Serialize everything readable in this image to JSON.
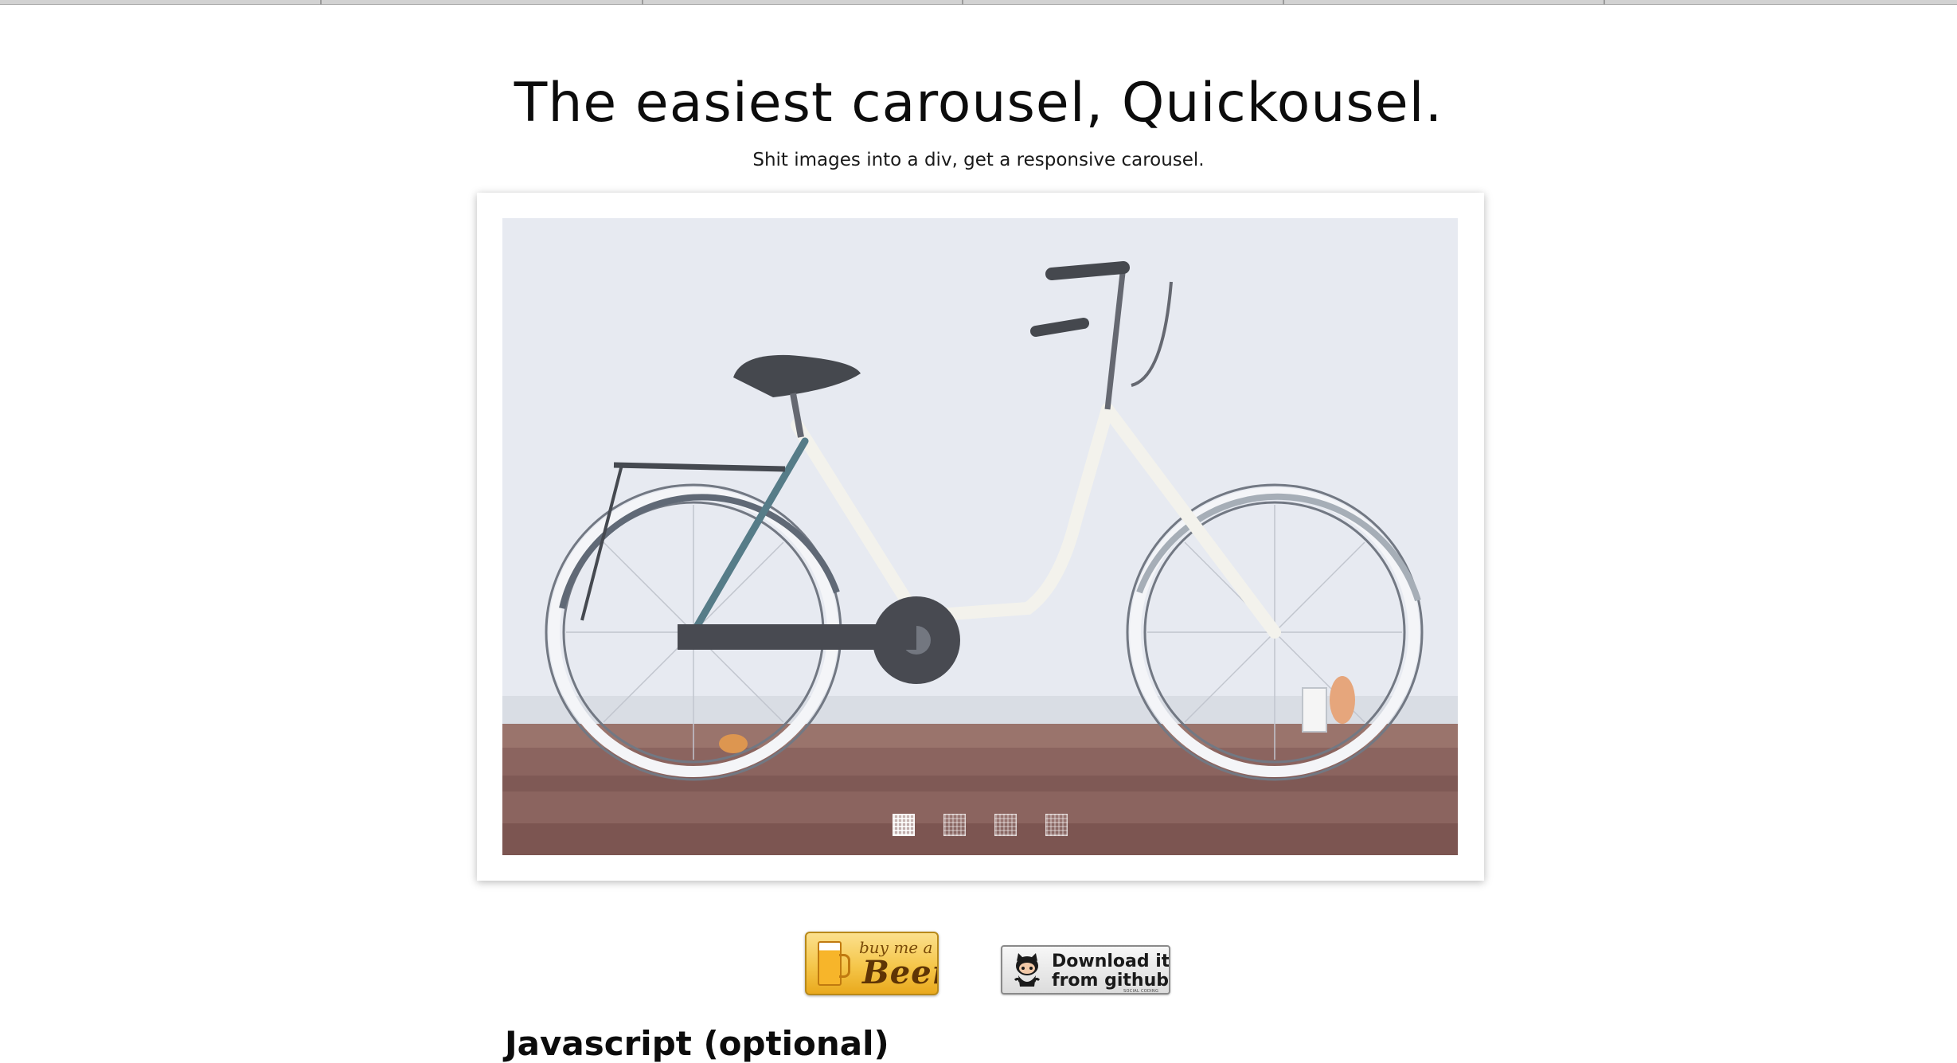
{
  "page": {
    "title": "The easiest carousel, Quickousel.",
    "subtitle": "Shit images into a div, get a responsive carousel."
  },
  "carousel": {
    "image": "bicycle-photo",
    "slide_count": 4,
    "active_slide": 1
  },
  "buttons": {
    "beer": {
      "line1": "buy me a",
      "line2": "Beer",
      "icon": "beer-mug-icon"
    },
    "github": {
      "line1": "Download it",
      "line2": "from github",
      "tiny": "SOCIAL CODING",
      "icon": "octocat-icon"
    }
  },
  "section": {
    "heading": "Javascript (optional)"
  },
  "colors": {
    "text": "#0c0c0c",
    "beer_gold": "#f5c64a",
    "frame_bg": "#ffffff"
  }
}
